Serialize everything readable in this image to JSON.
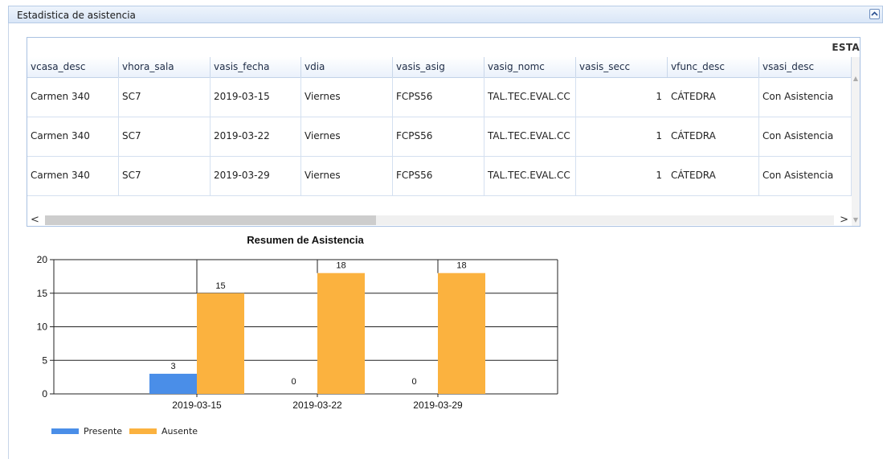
{
  "panel": {
    "title": "Estadistica de asistencia"
  },
  "grid": {
    "title": "ESTA",
    "columns": [
      "vcasa_desc",
      "vhora_sala",
      "vasis_fecha",
      "vdia",
      "vasis_asig",
      "vasig_nomc",
      "vasis_secc",
      "vfunc_desc",
      "vsasi_desc"
    ],
    "rows": [
      [
        "Carmen 340",
        "SC7",
        "2019-03-15",
        "Viernes",
        "FCPS56",
        "TAL.TEC.EVAL.CC",
        "1",
        "CÁTEDRA",
        "Con Asistencia"
      ],
      [
        "Carmen 340",
        "SC7",
        "2019-03-22",
        "Viernes",
        "FCPS56",
        "TAL.TEC.EVAL.CC",
        "1",
        "CÁTEDRA",
        "Con Asistencia"
      ],
      [
        "Carmen 340",
        "SC7",
        "2019-03-29",
        "Viernes",
        "FCPS56",
        "TAL.TEC.EVAL.CC",
        "1",
        "CÁTEDRA",
        "Con Asistencia"
      ]
    ],
    "scroll": {
      "left_arrow": "<",
      "right_arrow": ">",
      "up_arrow": "^",
      "down_arrow": "v"
    }
  },
  "chart_data": {
    "type": "bar",
    "title": "Resumen de Asistencia",
    "categories": [
      "2019-03-15",
      "2019-03-22",
      "2019-03-29"
    ],
    "series": [
      {
        "name": "Presente",
        "values": [
          3,
          0,
          0
        ],
        "color": "#4a8ee8"
      },
      {
        "name": "Ausente",
        "values": [
          15,
          18,
          18
        ],
        "color": "#fbb23f"
      }
    ],
    "ylim": [
      0,
      20
    ],
    "yticks": [
      0,
      5,
      10,
      15,
      20
    ],
    "grid": true,
    "legend": "bottom-left"
  }
}
